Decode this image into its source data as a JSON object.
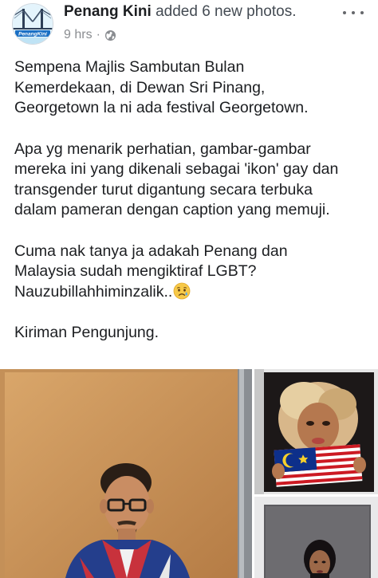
{
  "post": {
    "page_name": "Penang Kini",
    "action_text": "added 6 new photos.",
    "time": "9 hrs",
    "separator": "·",
    "privacy_icon": "globe-icon",
    "more_icon": "more-horizontal-icon",
    "avatar_logo_text": "PenangKini",
    "paragraphs": [
      "Sempena Majlis Sambutan Bulan\nKemerdekaan, di Dewan Sri Pinang,\nGeorgetown la ni ada festival Georgetown.",
      "Apa yg menarik perhatian, gambar-gambar\nmereka ini yang dikenali sebagai 'ikon' gay dan\ntransgender turut digantung secara terbuka\ndalam pameran dengan caption yang memuji.",
      "Cuma nak tanya ja adakah Penang dan\nMalaysia sudah mengiktiraf LGBT?\nNauzubillahhiminzalik..",
      "Kiriman Pengunjung."
    ],
    "emoji_icon": "sad-tear-face-icon",
    "photo_count": 6,
    "colors": {
      "name": "#1c1e21",
      "meta": "#8a8d91",
      "text": "#1c1e21"
    }
  }
}
